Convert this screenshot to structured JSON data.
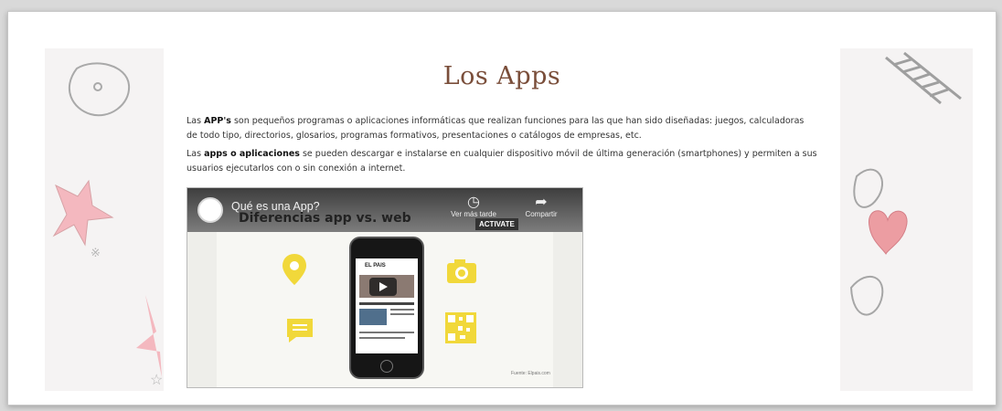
{
  "page": {
    "title": "Los Apps",
    "paragraph1": {
      "pre": "Las ",
      "bold": "APP's",
      "post": " son pequeños programas o aplicaciones informáticas que realizan funciones para las que han sido diseñadas: juegos, calculadoras de todo tipo, directorios, glosarios, programas formativos, presentaciones o catálogos de empresas, etc."
    },
    "paragraph2": {
      "pre": "Las ",
      "bold": "apps o aplicaciones",
      "post": " se pueden descargar e instalarse en cualquier dispositivo móvil de última generación (smartphones) y permiten a sus usuarios ejecutarlos con o sin conexión a internet."
    }
  },
  "video": {
    "title": "Qué es una App?",
    "slide_title": "Diferencias app vs. web",
    "watch_later": "Ver más tarde",
    "share": "Compartir",
    "badge": "ACTIVATE",
    "source": "Fuente: Elpais.com",
    "phone_news": "EL PAIS"
  },
  "colors": {
    "title": "#7a4e3a",
    "icon_yellow": "#f1d83a"
  },
  "icons": {
    "location": "location-icon",
    "camera": "camera-icon",
    "message": "message-icon",
    "qr": "qr-code-icon",
    "clock": "clock-icon",
    "share": "share-icon"
  }
}
